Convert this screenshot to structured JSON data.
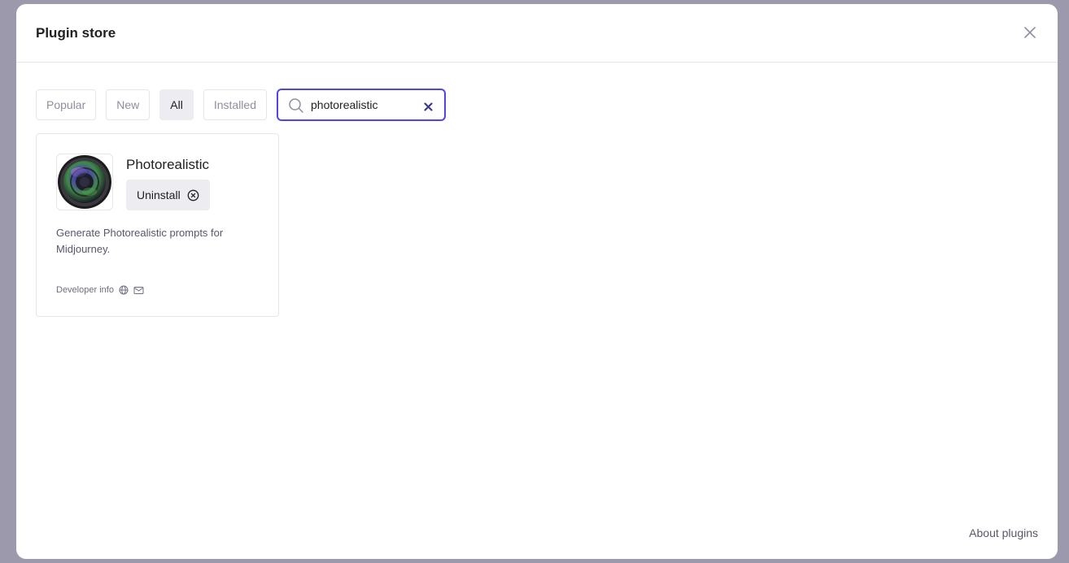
{
  "modal": {
    "title": "Plugin store",
    "close_icon": "close-icon"
  },
  "filters": {
    "tabs": [
      {
        "label": "Popular",
        "active": false
      },
      {
        "label": "New",
        "active": false
      },
      {
        "label": "All",
        "active": true
      },
      {
        "label": "Installed",
        "active": false
      }
    ]
  },
  "search": {
    "value": "photorealistic",
    "icon": "search-icon",
    "clear_icon": "clear-icon",
    "accent_color": "#5046e5"
  },
  "plugins": [
    {
      "name": "Photorealistic",
      "logo": "camera-lens-logo",
      "action_label": "Uninstall",
      "action_icon": "circle-x-icon",
      "description": "Generate Photorealistic prompts for Midjourney.",
      "developer_label": "Developer info",
      "developer_icons": [
        "globe-icon",
        "mail-icon"
      ]
    }
  ],
  "footer": {
    "about_label": "About plugins"
  }
}
